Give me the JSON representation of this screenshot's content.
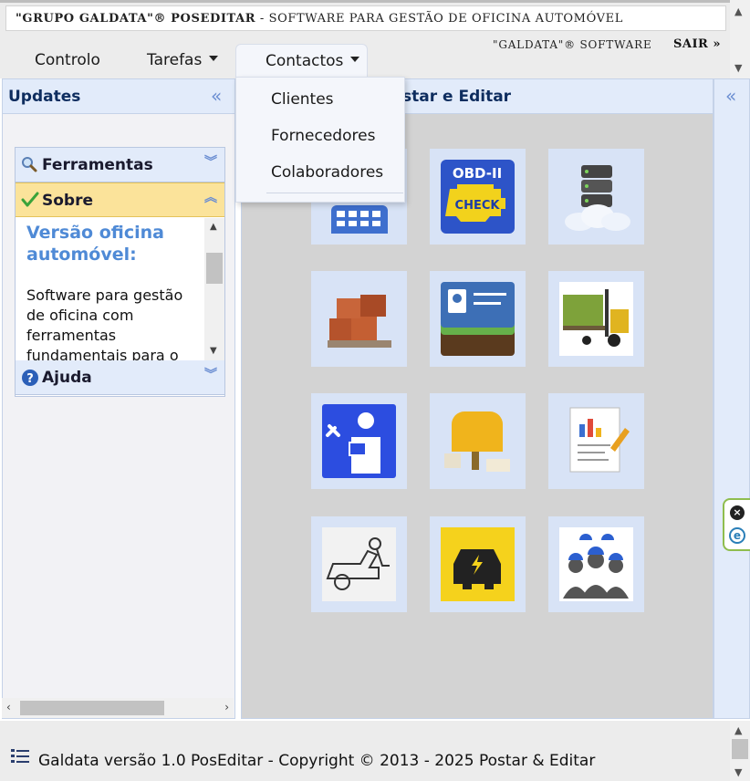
{
  "title_bar": {
    "brand": "\"GRUPO GALDATA\"® POSEDITAR",
    "subtitle": " - SOFTWARE PARA GESTÃO DE OFICINA AUTOMÓVEL"
  },
  "menu": {
    "items": [
      {
        "label": "Controlo"
      },
      {
        "label": "Tarefas"
      },
      {
        "label": "Contactos"
      }
    ],
    "brand_right": "\"GALDATA\"® SOFTWARE",
    "logout": "SAIR »"
  },
  "dropdown": {
    "items": [
      {
        "label": "Clientes"
      },
      {
        "label": "Fornecedores"
      },
      {
        "label": "Colaboradores"
      }
    ]
  },
  "west_panel": {
    "title": "Updates",
    "sections": [
      {
        "label": "Ferramentas",
        "icon": "magnifier-icon"
      },
      {
        "label": "Sobre",
        "icon": "checkmark-icon",
        "active": true
      },
      {
        "label": "Ajuda",
        "icon": "help-icon"
      }
    ],
    "about_title": "Versão oficina automóvel:",
    "about_text": "Software para gestão de oficina com ferramentas fundamentais para o"
  },
  "center_panel": {
    "title": "Software para Postar e Editar",
    "tiles": [
      {
        "icon": "calendar-icon"
      },
      {
        "icon": "obd-check-engine-icon",
        "text_top": "OBD-II",
        "text_badge": "CHECK"
      },
      {
        "icon": "cloud-server-icon"
      },
      {
        "icon": "boxes-pallet-icon"
      },
      {
        "icon": "contact-card-icon"
      },
      {
        "icon": "forklift-icon"
      },
      {
        "icon": "mechanic-manual-icon"
      },
      {
        "icon": "mailbox-parcels-icon"
      },
      {
        "icon": "report-chart-icon"
      },
      {
        "icon": "car-repair-icon"
      },
      {
        "icon": "electric-car-icon"
      },
      {
        "icon": "workers-team-icon"
      }
    ]
  },
  "footer": {
    "text": "Galdata versão 1.0 PosEditar - Copyright © 2013 - 2025 Postar & Editar"
  },
  "colors": {
    "panel_header": "#e2ebfa",
    "active_section": "#fbe39a",
    "tile_bg": "#d8e3f6",
    "center_bg": "#d3d3d3",
    "accent_blue": "#4f8ad6"
  }
}
